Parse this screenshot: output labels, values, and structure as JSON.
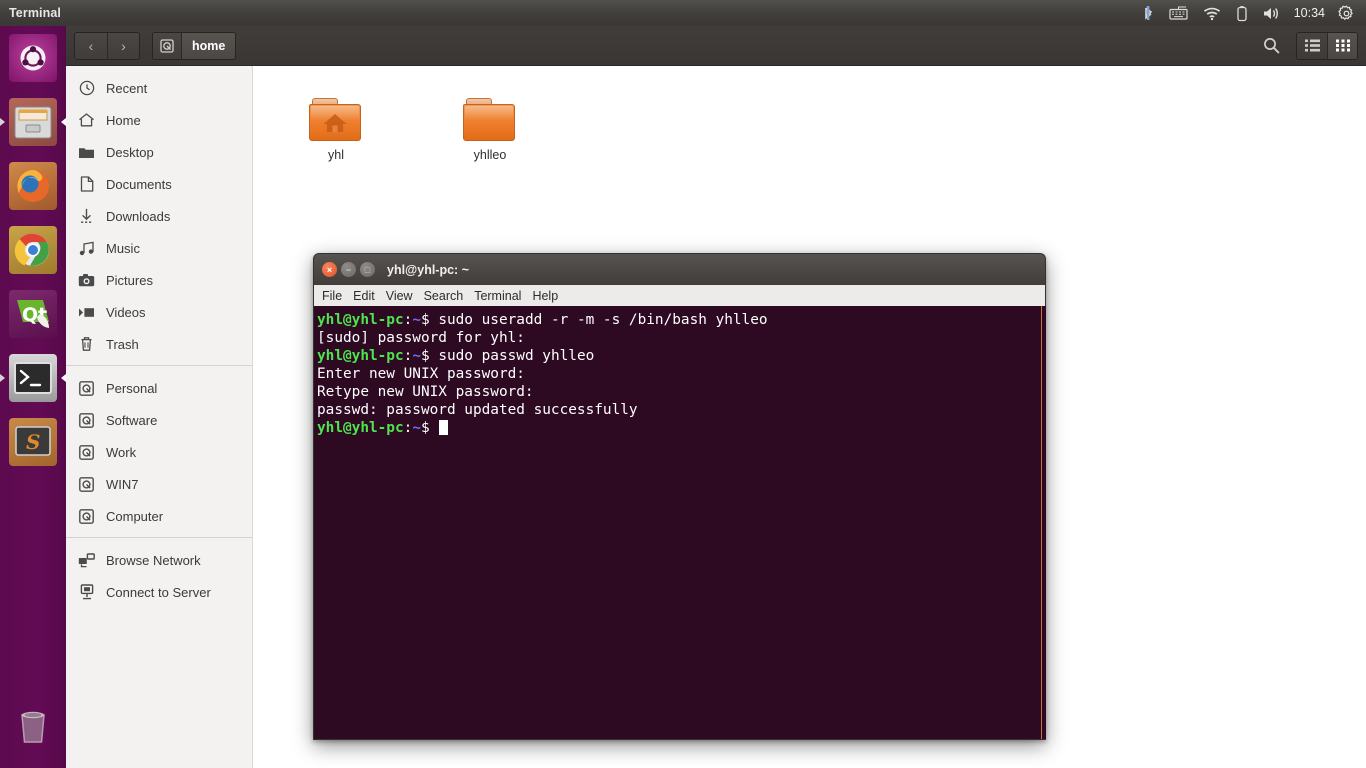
{
  "top_panel": {
    "app_title": "Terminal",
    "indicators": [
      {
        "name": "bluetooth-icon",
        "glyph": "bt"
      },
      {
        "name": "keyboard-icon",
        "glyph": "kb"
      },
      {
        "name": "wifi-icon",
        "glyph": "wifi"
      },
      {
        "name": "battery-icon",
        "glyph": "bat"
      },
      {
        "name": "volume-icon",
        "glyph": "vol"
      }
    ],
    "clock": "10:34",
    "session_menu": "gear-icon"
  },
  "launcher": {
    "items": [
      {
        "label": "Ubuntu Dash",
        "icon": "ubuntu-icon",
        "running": false
      },
      {
        "label": "Files",
        "icon": "files-icon",
        "running": true
      },
      {
        "label": "Firefox Web Browser",
        "icon": "firefox-icon",
        "running": false
      },
      {
        "label": "Google Chrome",
        "icon": "chrome-icon",
        "running": false
      },
      {
        "label": "Qt Creator",
        "icon": "qt-icon",
        "running": false
      },
      {
        "label": "Terminal",
        "icon": "terminal-icon",
        "running": true
      },
      {
        "label": "Sublime Text",
        "icon": "sublime-icon",
        "running": false
      }
    ],
    "trash": {
      "label": "Trash",
      "icon": "trash-icon"
    }
  },
  "file_manager": {
    "toolbar": {
      "back_label": "‹",
      "forward_label": "›",
      "path_device_icon": "drive-icon",
      "current_path": "home",
      "search_label": "search-icon",
      "list_view_label": "list-view-icon",
      "grid_view_label": "grid-view-icon",
      "active_view": "grid"
    },
    "places": [
      {
        "label": "Recent",
        "icon": "clock-icon"
      },
      {
        "label": "Home",
        "icon": "home-icon"
      },
      {
        "label": "Desktop",
        "icon": "desktop-folder-icon"
      },
      {
        "label": "Documents",
        "icon": "document-icon"
      },
      {
        "label": "Downloads",
        "icon": "download-icon"
      },
      {
        "label": "Music",
        "icon": "music-note-icon"
      },
      {
        "label": "Pictures",
        "icon": "camera-icon"
      },
      {
        "label": "Videos",
        "icon": "video-icon"
      },
      {
        "label": "Trash",
        "icon": "trash-icon"
      }
    ],
    "devices": [
      {
        "label": "Personal",
        "icon": "drive-icon"
      },
      {
        "label": "Software",
        "icon": "drive-icon"
      },
      {
        "label": "Work",
        "icon": "drive-icon"
      },
      {
        "label": "WIN7",
        "icon": "drive-icon"
      },
      {
        "label": "Computer",
        "icon": "drive-icon"
      }
    ],
    "network": [
      {
        "label": "Browse Network",
        "icon": "network-icon"
      },
      {
        "label": "Connect to Server",
        "icon": "server-icon"
      }
    ],
    "files": [
      {
        "label": "yhl",
        "icon": "home-folder-icon"
      },
      {
        "label": "yhlleo",
        "icon": "folder-icon"
      }
    ]
  },
  "terminal": {
    "title": "yhl@yhl-pc: ~",
    "window_controls": {
      "close": "×",
      "minimize": "−",
      "maximize": "□"
    },
    "menu": [
      "File",
      "Edit",
      "View",
      "Search",
      "Terminal",
      "Help"
    ],
    "prompt": {
      "user_host": "yhl@yhl-pc",
      "colon": ":",
      "path": "~",
      "symbol": "$"
    },
    "lines": [
      {
        "type": "prompt",
        "command": " sudo useradd -r -m -s /bin/bash yhlleo"
      },
      {
        "type": "output",
        "text": "[sudo] password for yhl:"
      },
      {
        "type": "prompt",
        "command": " sudo passwd yhlleo"
      },
      {
        "type": "output",
        "text": "Enter new UNIX password:"
      },
      {
        "type": "output",
        "text": "Retype new UNIX password:"
      },
      {
        "type": "output",
        "text": "passwd: password updated successfully"
      },
      {
        "type": "prompt-cursor",
        "command": " "
      }
    ],
    "colors": {
      "background": "#2d0922",
      "foreground": "#ffffff",
      "prompt_user": "#4ee44e",
      "prompt_path": "#6b6bff"
    }
  }
}
